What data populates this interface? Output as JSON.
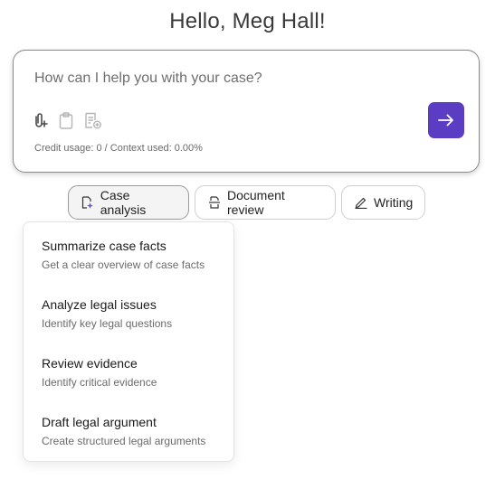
{
  "greeting": "Hello, Meg Hall!",
  "composer": {
    "placeholder": "How can I help you with your case?",
    "value": "",
    "credit_usage": "Credit usage: 0 / Context used: 0.00%",
    "tools": [
      {
        "icon": "attach-file-icon"
      },
      {
        "icon": "clipboard-icon"
      },
      {
        "icon": "document-add-icon"
      }
    ],
    "send_icon": "arrow-right-icon",
    "accent_color": "#5b3dc4"
  },
  "modes": [
    {
      "label": "Case analysis",
      "icon": "document-sparkle-icon",
      "active": true
    },
    {
      "label": "Document review",
      "icon": "document-scan-icon",
      "active": false
    },
    {
      "label": "Writing",
      "icon": "pen-icon",
      "active": false
    }
  ],
  "dropdown": {
    "items": [
      {
        "title": "Summarize case facts",
        "description": "Get a clear overview of case facts"
      },
      {
        "title": "Analyze legal issues",
        "description": "Identify key legal questions"
      },
      {
        "title": "Review evidence",
        "description": "Identify critical evidence"
      },
      {
        "title": "Draft legal argument",
        "description": "Create structured legal arguments"
      }
    ]
  }
}
